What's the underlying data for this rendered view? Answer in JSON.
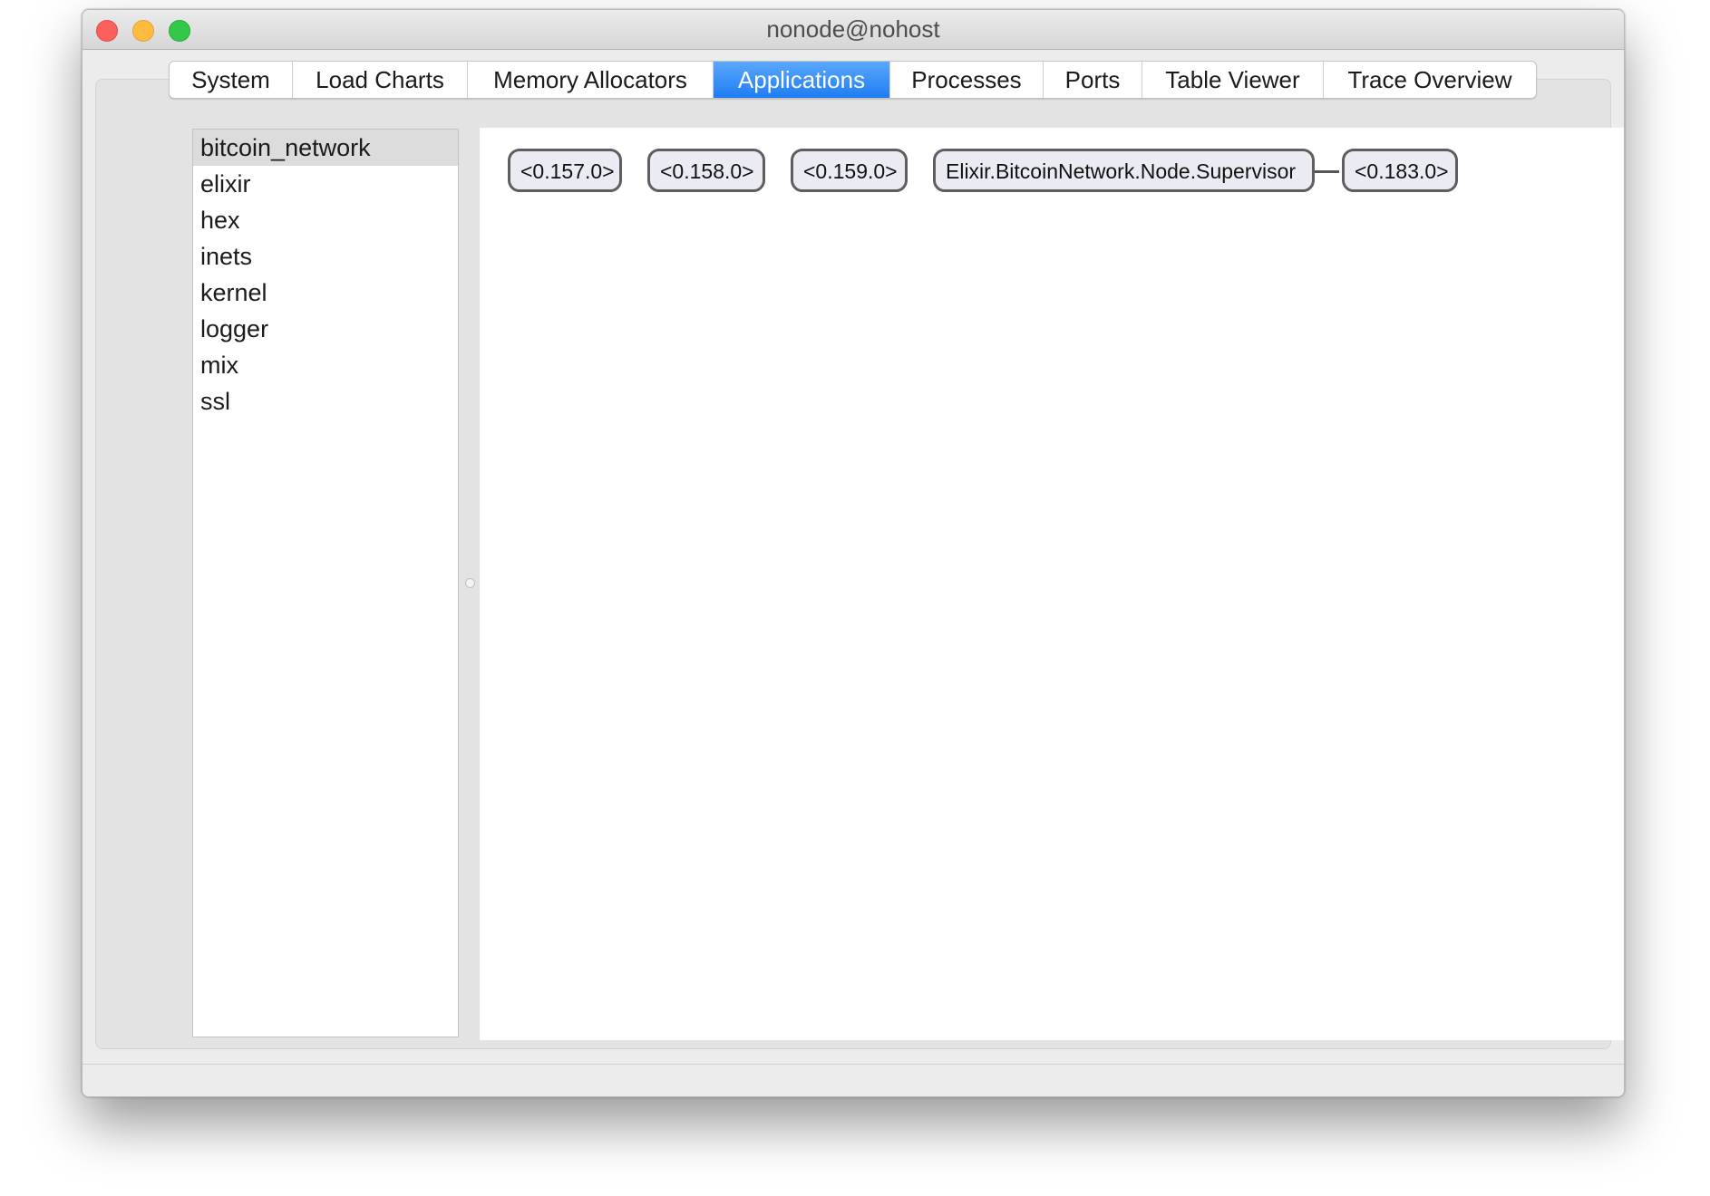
{
  "window": {
    "title": "nonode@nohost"
  },
  "tabs": [
    {
      "label": "System"
    },
    {
      "label": "Load Charts"
    },
    {
      "label": "Memory Allocators"
    },
    {
      "label": "Applications",
      "active": true
    },
    {
      "label": "Processes"
    },
    {
      "label": "Ports"
    },
    {
      "label": "Table Viewer"
    },
    {
      "label": "Trace Overview"
    }
  ],
  "applications": {
    "selected": "bitcoin_network",
    "items": [
      {
        "label": "bitcoin_network"
      },
      {
        "label": "elixir"
      },
      {
        "label": "hex"
      },
      {
        "label": "inets"
      },
      {
        "label": "kernel"
      },
      {
        "label": "logger"
      },
      {
        "label": "mix"
      },
      {
        "label": "ssl"
      }
    ]
  },
  "process_tree": {
    "nodes": [
      {
        "label": "<0.157.0>"
      },
      {
        "label": "<0.158.0>"
      },
      {
        "label": "<0.159.0>"
      },
      {
        "label": "Elixir.BitcoinNetwork.Node.Supervisor"
      },
      {
        "label": "<0.183.0>"
      }
    ]
  },
  "colors": {
    "active_tab": "#1e7cf3",
    "selected_row": "#dcdcdc",
    "node_fill": "#ebebf4",
    "node_border": "#5e5e5e",
    "close_button": "#fc605c",
    "minimize_button": "#fdbc40",
    "zoom_button": "#34c84a"
  }
}
